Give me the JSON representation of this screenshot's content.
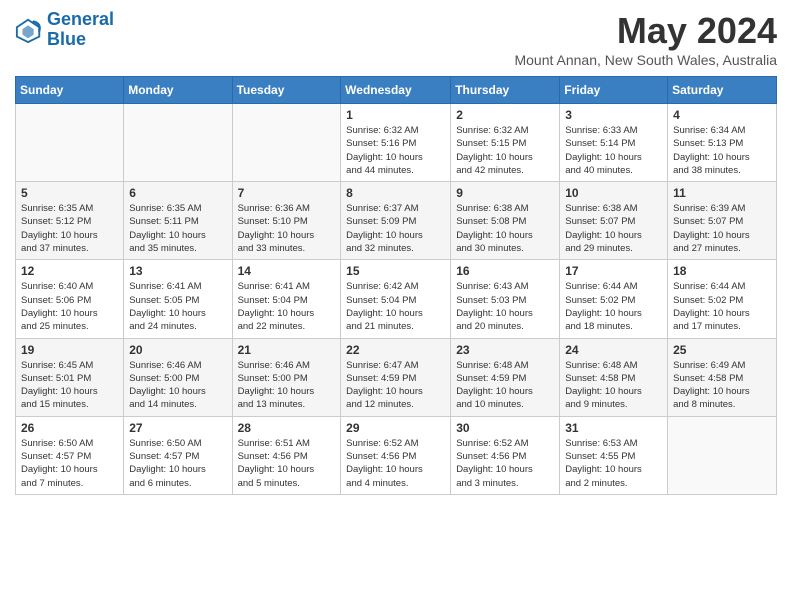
{
  "logo": {
    "line1": "General",
    "line2": "Blue"
  },
  "title": "May 2024",
  "location": "Mount Annan, New South Wales, Australia",
  "weekdays": [
    "Sunday",
    "Monday",
    "Tuesday",
    "Wednesday",
    "Thursday",
    "Friday",
    "Saturday"
  ],
  "weeks": [
    [
      {
        "day": "",
        "info": ""
      },
      {
        "day": "",
        "info": ""
      },
      {
        "day": "",
        "info": ""
      },
      {
        "day": "1",
        "info": "Sunrise: 6:32 AM\nSunset: 5:16 PM\nDaylight: 10 hours\nand 44 minutes."
      },
      {
        "day": "2",
        "info": "Sunrise: 6:32 AM\nSunset: 5:15 PM\nDaylight: 10 hours\nand 42 minutes."
      },
      {
        "day": "3",
        "info": "Sunrise: 6:33 AM\nSunset: 5:14 PM\nDaylight: 10 hours\nand 40 minutes."
      },
      {
        "day": "4",
        "info": "Sunrise: 6:34 AM\nSunset: 5:13 PM\nDaylight: 10 hours\nand 38 minutes."
      }
    ],
    [
      {
        "day": "5",
        "info": "Sunrise: 6:35 AM\nSunset: 5:12 PM\nDaylight: 10 hours\nand 37 minutes."
      },
      {
        "day": "6",
        "info": "Sunrise: 6:35 AM\nSunset: 5:11 PM\nDaylight: 10 hours\nand 35 minutes."
      },
      {
        "day": "7",
        "info": "Sunrise: 6:36 AM\nSunset: 5:10 PM\nDaylight: 10 hours\nand 33 minutes."
      },
      {
        "day": "8",
        "info": "Sunrise: 6:37 AM\nSunset: 5:09 PM\nDaylight: 10 hours\nand 32 minutes."
      },
      {
        "day": "9",
        "info": "Sunrise: 6:38 AM\nSunset: 5:08 PM\nDaylight: 10 hours\nand 30 minutes."
      },
      {
        "day": "10",
        "info": "Sunrise: 6:38 AM\nSunset: 5:07 PM\nDaylight: 10 hours\nand 29 minutes."
      },
      {
        "day": "11",
        "info": "Sunrise: 6:39 AM\nSunset: 5:07 PM\nDaylight: 10 hours\nand 27 minutes."
      }
    ],
    [
      {
        "day": "12",
        "info": "Sunrise: 6:40 AM\nSunset: 5:06 PM\nDaylight: 10 hours\nand 25 minutes."
      },
      {
        "day": "13",
        "info": "Sunrise: 6:41 AM\nSunset: 5:05 PM\nDaylight: 10 hours\nand 24 minutes."
      },
      {
        "day": "14",
        "info": "Sunrise: 6:41 AM\nSunset: 5:04 PM\nDaylight: 10 hours\nand 22 minutes."
      },
      {
        "day": "15",
        "info": "Sunrise: 6:42 AM\nSunset: 5:04 PM\nDaylight: 10 hours\nand 21 minutes."
      },
      {
        "day": "16",
        "info": "Sunrise: 6:43 AM\nSunset: 5:03 PM\nDaylight: 10 hours\nand 20 minutes."
      },
      {
        "day": "17",
        "info": "Sunrise: 6:44 AM\nSunset: 5:02 PM\nDaylight: 10 hours\nand 18 minutes."
      },
      {
        "day": "18",
        "info": "Sunrise: 6:44 AM\nSunset: 5:02 PM\nDaylight: 10 hours\nand 17 minutes."
      }
    ],
    [
      {
        "day": "19",
        "info": "Sunrise: 6:45 AM\nSunset: 5:01 PM\nDaylight: 10 hours\nand 15 minutes."
      },
      {
        "day": "20",
        "info": "Sunrise: 6:46 AM\nSunset: 5:00 PM\nDaylight: 10 hours\nand 14 minutes."
      },
      {
        "day": "21",
        "info": "Sunrise: 6:46 AM\nSunset: 5:00 PM\nDaylight: 10 hours\nand 13 minutes."
      },
      {
        "day": "22",
        "info": "Sunrise: 6:47 AM\nSunset: 4:59 PM\nDaylight: 10 hours\nand 12 minutes."
      },
      {
        "day": "23",
        "info": "Sunrise: 6:48 AM\nSunset: 4:59 PM\nDaylight: 10 hours\nand 10 minutes."
      },
      {
        "day": "24",
        "info": "Sunrise: 6:48 AM\nSunset: 4:58 PM\nDaylight: 10 hours\nand 9 minutes."
      },
      {
        "day": "25",
        "info": "Sunrise: 6:49 AM\nSunset: 4:58 PM\nDaylight: 10 hours\nand 8 minutes."
      }
    ],
    [
      {
        "day": "26",
        "info": "Sunrise: 6:50 AM\nSunset: 4:57 PM\nDaylight: 10 hours\nand 7 minutes."
      },
      {
        "day": "27",
        "info": "Sunrise: 6:50 AM\nSunset: 4:57 PM\nDaylight: 10 hours\nand 6 minutes."
      },
      {
        "day": "28",
        "info": "Sunrise: 6:51 AM\nSunset: 4:56 PM\nDaylight: 10 hours\nand 5 minutes."
      },
      {
        "day": "29",
        "info": "Sunrise: 6:52 AM\nSunset: 4:56 PM\nDaylight: 10 hours\nand 4 minutes."
      },
      {
        "day": "30",
        "info": "Sunrise: 6:52 AM\nSunset: 4:56 PM\nDaylight: 10 hours\nand 3 minutes."
      },
      {
        "day": "31",
        "info": "Sunrise: 6:53 AM\nSunset: 4:55 PM\nDaylight: 10 hours\nand 2 minutes."
      },
      {
        "day": "",
        "info": ""
      }
    ]
  ]
}
